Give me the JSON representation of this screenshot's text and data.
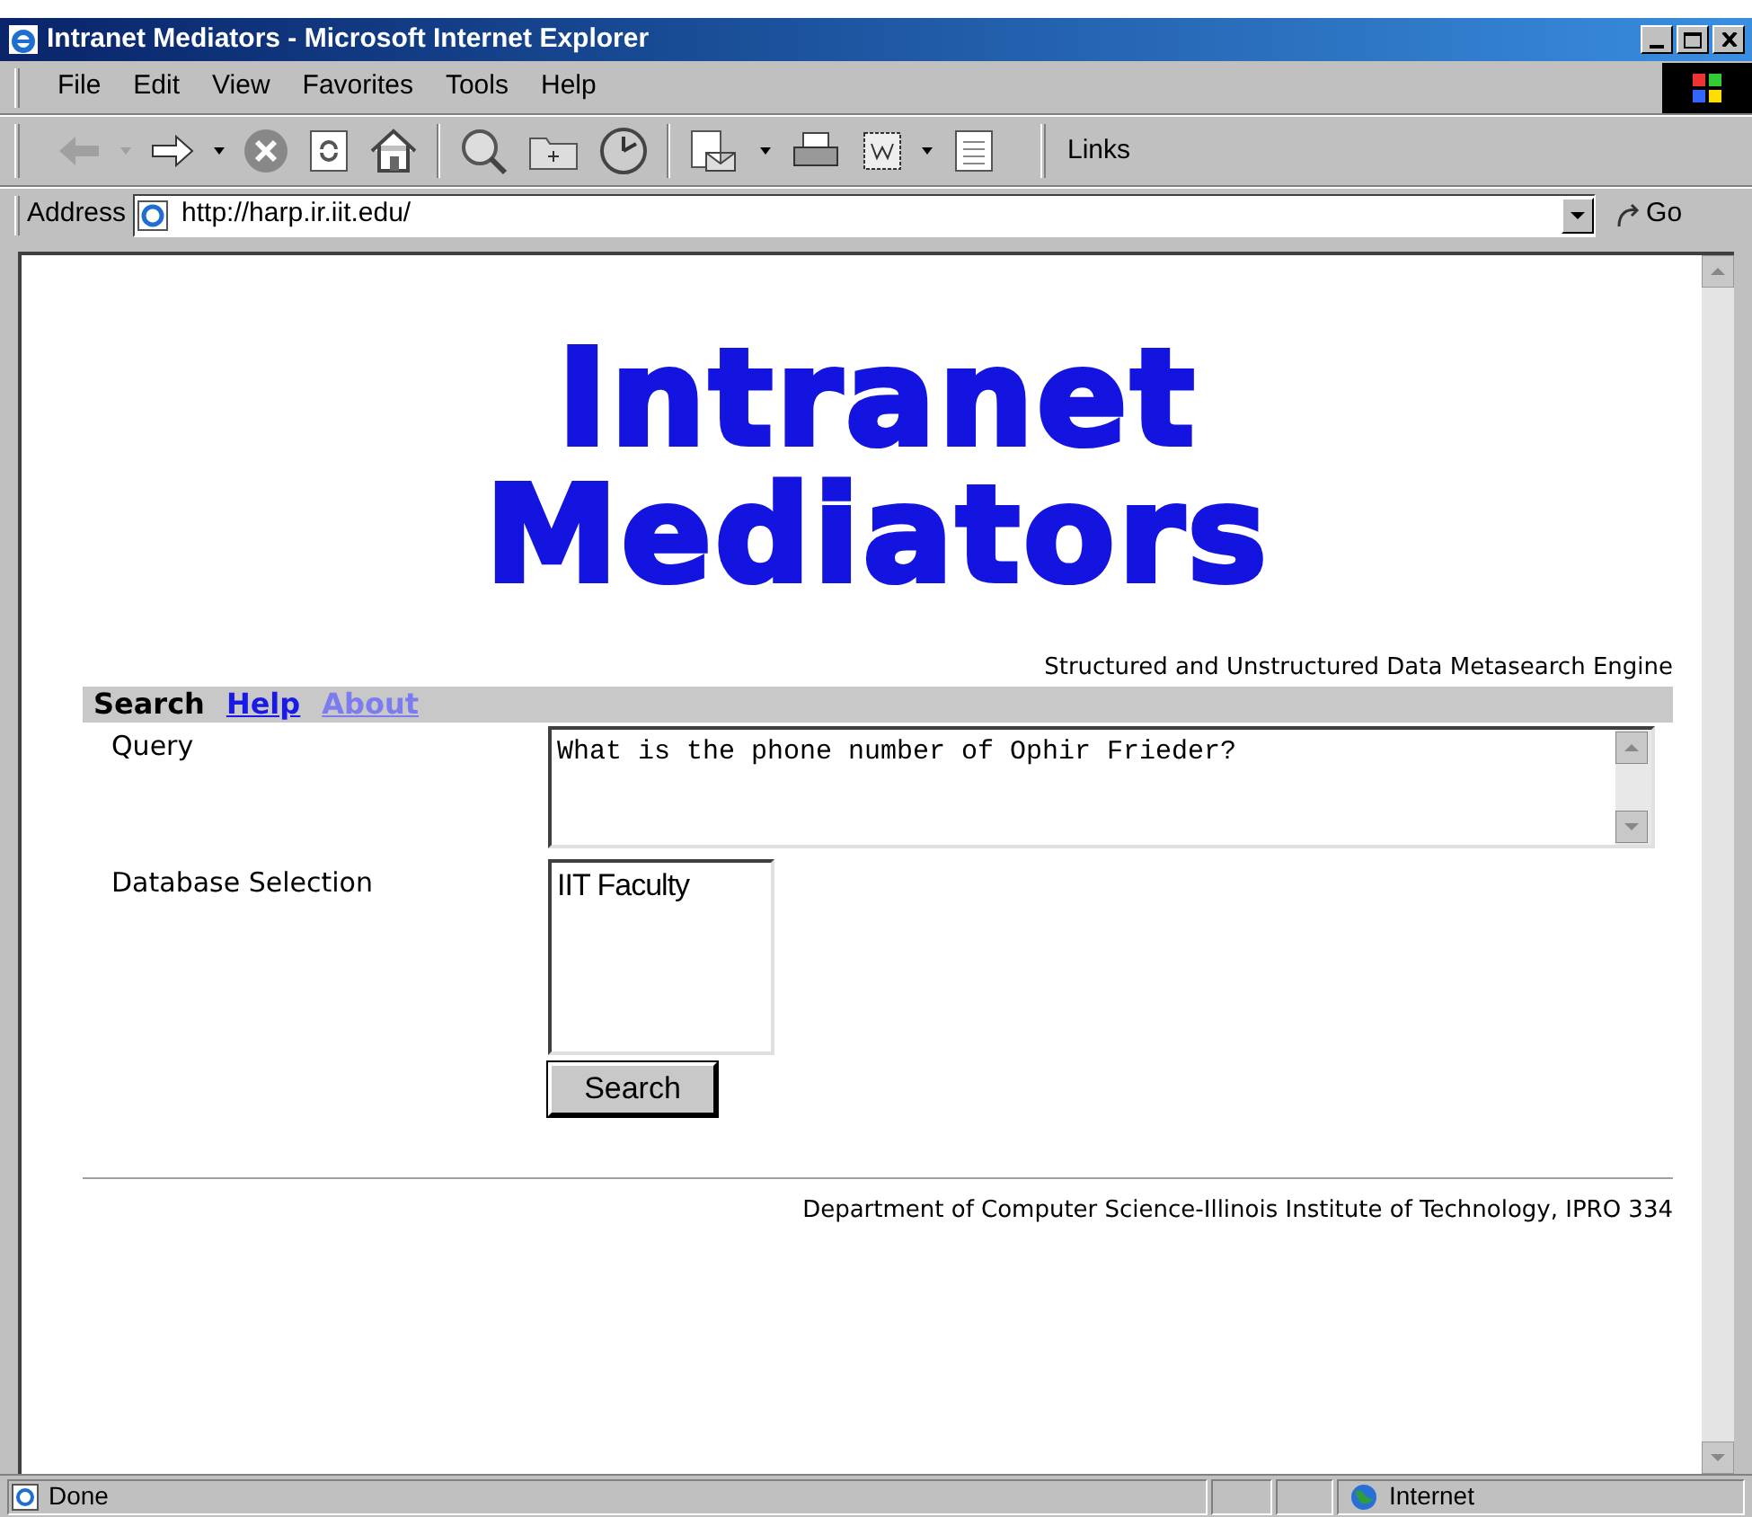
{
  "window": {
    "title": "Intranet Mediators - Microsoft Internet Explorer"
  },
  "menu": [
    "File",
    "Edit",
    "View",
    "Favorites",
    "Tools",
    "Help"
  ],
  "toolbar": {
    "links_label": "Links"
  },
  "address": {
    "label": "Address",
    "value": "http://harp.ir.iit.edu/",
    "go": "Go"
  },
  "page": {
    "heading_lines": [
      "Intranet",
      "Mediators"
    ],
    "tagline": "Structured and Unstructured Data Metasearch Engine",
    "nav": [
      {
        "label": "Search",
        "kind": "current"
      },
      {
        "label": "Help",
        "kind": "link"
      },
      {
        "label": "About",
        "kind": "visited"
      }
    ],
    "query_label": "Query",
    "query_value": "What is the phone number of Ophir Frieder?",
    "database_label": "Database Selection",
    "databases": [
      {
        "label": "IIT Faculty",
        "selected": false
      }
    ],
    "search_button": "Search",
    "footer": "Department of Computer Science-Illinois Institute of Technology, IPRO 334"
  },
  "status_bar": {
    "text": "Done",
    "zone": "Internet"
  }
}
